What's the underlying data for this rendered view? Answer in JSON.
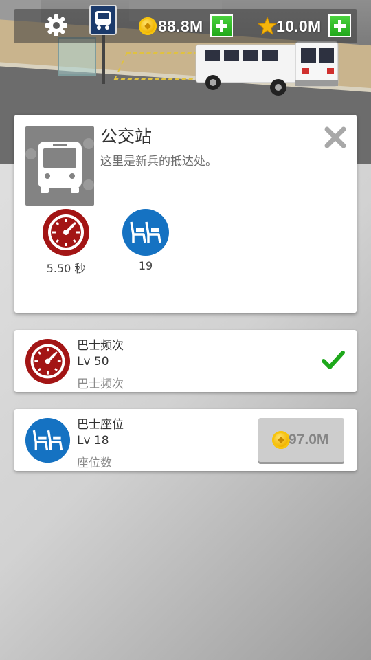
{
  "hud": {
    "coins": "88.8M",
    "stars": "10.0M",
    "icons": [
      "gear-icon",
      "bus-stop-sign-icon",
      "coin-icon",
      "add-icon",
      "star-icon",
      "add-icon"
    ]
  },
  "info_card": {
    "title": "公交站",
    "description": "这里是新兵的抵达处。",
    "stats": [
      {
        "icon": "speedometer-icon",
        "color": "#a31515",
        "label": "5.50 秒"
      },
      {
        "icon": "seat-icon",
        "color": "#1572c2",
        "label": "19"
      }
    ]
  },
  "upgrades": [
    {
      "icon": "speedometer-icon",
      "name": "巴士频次",
      "level": "Lv 50",
      "subtitle": "巴士频次",
      "status": "maxed"
    },
    {
      "icon": "seat-icon",
      "name": "巴士座位",
      "level": "Lv 18",
      "subtitle": "座位数",
      "cost": "97.0M"
    }
  ],
  "colors": {
    "accent_green": "#22a81b",
    "speed_red": "#a31515",
    "seat_blue": "#1572c2",
    "gold": "#f1b400"
  }
}
